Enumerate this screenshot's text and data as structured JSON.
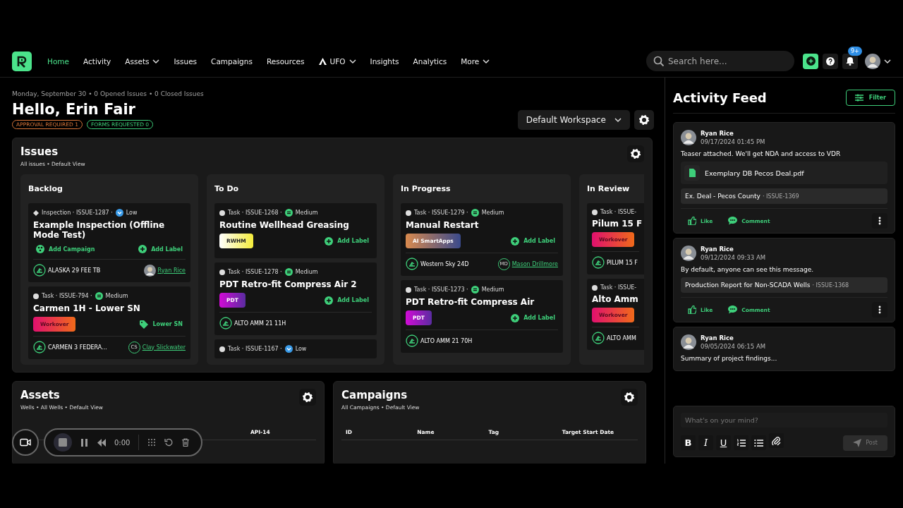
{
  "nav": {
    "items": [
      {
        "label": "Home",
        "selected": true,
        "dropdown": false,
        "has_icon": false
      },
      {
        "label": "Activity",
        "selected": false,
        "dropdown": false,
        "has_icon": false
      },
      {
        "label": "Assets",
        "selected": false,
        "dropdown": true,
        "has_icon": false
      },
      {
        "label": "Issues",
        "selected": false,
        "dropdown": false,
        "has_icon": false
      },
      {
        "label": "Campaigns",
        "selected": false,
        "dropdown": false,
        "has_icon": false
      },
      {
        "label": "Resources",
        "selected": false,
        "dropdown": false,
        "has_icon": false
      },
      {
        "label": "UFO",
        "selected": false,
        "dropdown": true,
        "has_icon": true
      },
      {
        "label": "Insights",
        "selected": false,
        "dropdown": false,
        "has_icon": false
      },
      {
        "label": "Analytics",
        "selected": false,
        "dropdown": false,
        "has_icon": false
      },
      {
        "label": "More",
        "selected": false,
        "dropdown": true,
        "has_icon": false
      }
    ]
  },
  "search": {
    "placeholder": "Search here..."
  },
  "notifications": {
    "badge": "9+"
  },
  "greeting": {
    "summary": "Monday, September 30 • 0 Opened Issues • 0 Closed Issues",
    "title": "Hello, Erin Fair",
    "badges": [
      {
        "label": "APPROVAL REQUIRED 1",
        "color": "#d9773a"
      },
      {
        "label": "FORMS REQUESTED 0",
        "color": "#3ecf7a"
      }
    ]
  },
  "workspace": {
    "label": "Default Workspace"
  },
  "issues": {
    "title": "Issues",
    "subtitle": "All issues • Default View",
    "columns": [
      {
        "title": "Backlog",
        "cards": [
          {
            "kind": "inspection",
            "meta": "Inspection · ISSUE-1287 ·",
            "priority": {
              "label": "Low",
              "kind": "low"
            },
            "title": "Example Inspection (Offline Mode Test)",
            "campaign_action": "Add Campaign",
            "label_action": {
              "label": "Add Label",
              "kind": "add"
            },
            "asset": "ALASKA 29 FEE TB",
            "assignee": {
              "name": "Ryan Rice",
              "kind": "photo"
            }
          },
          {
            "kind": "task",
            "meta": "Task · ISSUE-794 ·",
            "priority": {
              "label": "Medium",
              "kind": "medium"
            },
            "title": "Carmen 1H - Lower SN",
            "tag": {
              "label": "Workover",
              "kind": "workover"
            },
            "label_action": {
              "label": "Lower SN",
              "kind": "tag"
            },
            "asset": "CARMEN 3 FEDERA...",
            "assignee": {
              "name": "Clay Slickwater",
              "kind": "initials",
              "initials": "CS"
            }
          }
        ]
      },
      {
        "title": "To Do",
        "cards": [
          {
            "kind": "task",
            "meta": "Task · ISSUE-1268 ·",
            "priority": {
              "label": "Medium",
              "kind": "medium"
            },
            "title": "Routine Wellhead Greasing",
            "tag": {
              "label": "RWHM",
              "kind": "rwhm"
            },
            "label_action": {
              "label": "Add Label",
              "kind": "add"
            }
          },
          {
            "kind": "task",
            "meta": "Task · ISSUE-1278 ·",
            "priority": {
              "label": "Medium",
              "kind": "medium"
            },
            "title": "PDT Retro-fit Compress Air 2",
            "tag": {
              "label": "PDT",
              "kind": "pdt"
            },
            "label_action": {
              "label": "Add Label",
              "kind": "add"
            },
            "asset": "ALTO AMM 21 11H"
          },
          {
            "kind": "task",
            "meta": "Task · ISSUE-1167 ·",
            "priority": {
              "label": "Low",
              "kind": "low"
            }
          }
        ]
      },
      {
        "title": "In Progress",
        "cards": [
          {
            "kind": "task",
            "meta": "Task · ISSUE-1279 ·",
            "priority": {
              "label": "Medium",
              "kind": "medium"
            },
            "title": "Manual Restart",
            "tag": {
              "label": "AI SmartApps",
              "kind": "ai"
            },
            "label_action": {
              "label": "Add Label",
              "kind": "add"
            },
            "asset": "Western Sky 24D",
            "assignee": {
              "name": "Mason Drillmore",
              "kind": "initials",
              "initials": "MD"
            }
          },
          {
            "kind": "task",
            "meta": "Task · ISSUE-1273 ·",
            "priority": {
              "label": "Medium",
              "kind": "medium"
            },
            "title": "PDT Retro-fit Compress Air",
            "tag": {
              "label": "PDT",
              "kind": "pdt"
            },
            "label_action": {
              "label": "Add Label",
              "kind": "add"
            },
            "asset": "ALTO AMM 21 70H"
          }
        ]
      },
      {
        "title": "In Review",
        "cards": [
          {
            "kind": "task",
            "meta": "Task · ISSUE-",
            "title": "Pilum 15 F",
            "tag": {
              "label": "Workover",
              "kind": "workover"
            },
            "asset": "PILUM 15 F"
          },
          {
            "kind": "task",
            "meta": "Task · ISSUE-",
            "title": "Alto Amm",
            "tag": {
              "label": "Workover",
              "kind": "workover"
            },
            "asset": "ALTO AMM"
          }
        ]
      }
    ]
  },
  "assets": {
    "title": "Assets",
    "subtitle": "Wells • All Wells • Default View",
    "columns": [
      "API-14"
    ]
  },
  "campaigns": {
    "title": "Campaigns",
    "subtitle": "All Campaigns • Default View",
    "columns": [
      "ID",
      "Name",
      "Tag",
      "Target Start Date"
    ]
  },
  "feed": {
    "title": "Activity Feed",
    "filter": "Filter",
    "posts": [
      {
        "author": "Ryan Rice",
        "time": "09/17/2024 01:45 PM",
        "text": "Teaser attached. We'll get NDA and access to VDR",
        "attachment": "Exemplary DB Pecos Deal.pdf",
        "link": {
          "title": "Ex. Deal - Pecos County",
          "meta": "· ISSUE-1369"
        },
        "actions": [
          "Like",
          "Comment"
        ]
      },
      {
        "author": "Ryan Rice",
        "time": "09/12/2024 09:33 AM",
        "text": "By default, anyone can see this message.",
        "link": {
          "title": "Production Report for Non-SCADA Wells",
          "meta": "· ISSUE-1368"
        },
        "actions": [
          "Like",
          "Comment"
        ]
      },
      {
        "author": "Ryan Rice",
        "time": "09/05/2024 06:15 AM",
        "text": "Summary of project findings..."
      }
    ],
    "composer": {
      "placeholder": "What's on your mind?",
      "tools": [
        {
          "kind": "bold",
          "label": "B"
        },
        {
          "kind": "italic",
          "label": "I"
        },
        {
          "kind": "underline",
          "label": "U"
        },
        {
          "kind": "ordered"
        },
        {
          "kind": "bullets"
        },
        {
          "kind": "attach"
        }
      ],
      "post": {
        "label": "Post",
        "disabled": true
      }
    }
  },
  "recorder": {
    "time": "0:00"
  }
}
